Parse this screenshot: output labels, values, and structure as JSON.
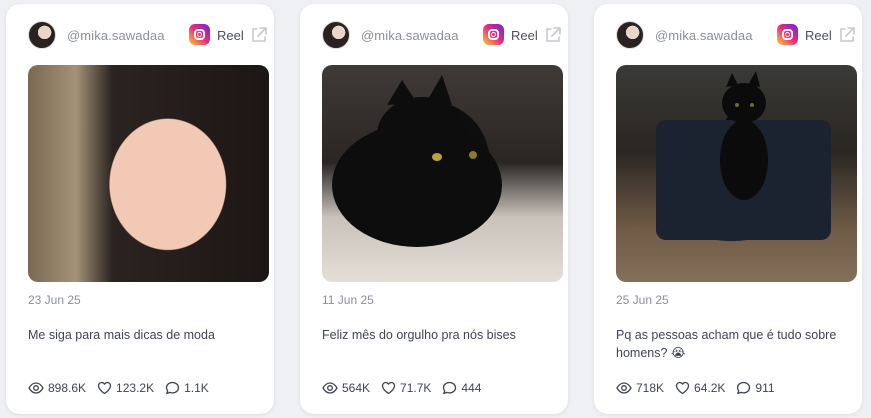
{
  "cards": [
    {
      "handle": "@mika.sawadaa",
      "platform_label": "Reel",
      "date": "23 Jun 25",
      "caption": "Me siga para mais dicas de moda",
      "views": "898.6K",
      "likes": "123.2K",
      "comments": "1.1K"
    },
    {
      "handle": "@mika.sawadaa",
      "platform_label": "Reel",
      "date": "11 Jun 25",
      "caption": "Feliz mês do orgulho pra nós bises",
      "views": "564K",
      "likes": "71.7K",
      "comments": "444"
    },
    {
      "handle": "@mika.sawadaa",
      "platform_label": "Reel",
      "date": "25 Jun 25",
      "caption": "Pq as pessoas acham que é tudo sobre homens? 😭",
      "views": "718K",
      "likes": "64.2K",
      "comments": "911"
    }
  ],
  "icons": {
    "platform": "instagram-icon",
    "external": "external-link-icon",
    "views": "eye-icon",
    "likes": "heart-icon",
    "comments": "comment-icon"
  },
  "colors": {
    "text_muted": "#8a8f98",
    "text_main": "#3f4452",
    "background": "#eef0f3"
  }
}
